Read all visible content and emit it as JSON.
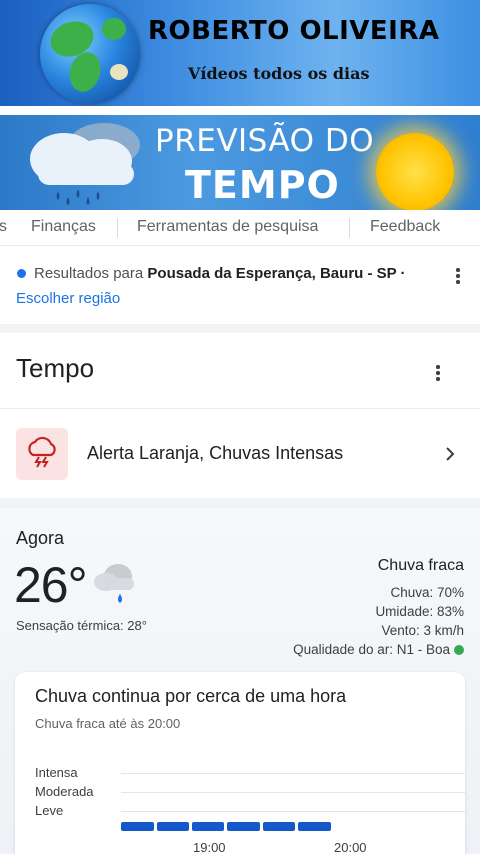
{
  "banner_top": {
    "title": "ROBERTO OLIVEIRA",
    "subtitle": "Vídeos todos os dias"
  },
  "banner_weather": {
    "line1": "PREVISÃO DO",
    "line2": "TEMPO"
  },
  "tabs": [
    {
      "label": "s"
    },
    {
      "label": "Finanças"
    },
    {
      "label": "Ferramentas de pesquisa"
    },
    {
      "label": "Feedback"
    }
  ],
  "location": {
    "prefix": "Resultados para ",
    "place": "Pousada da Esperança, Bauru - SP ·",
    "change_link": "Escolher região"
  },
  "tempo": {
    "heading": "Tempo"
  },
  "alert": {
    "label": "Alerta Laranja, Chuvas Intensas",
    "color": "#fbe3e3"
  },
  "now": {
    "label": "Agora",
    "temperature": "26°",
    "feels_like": "Sensação térmica: 28°",
    "condition": "Chuva fraca",
    "rain": "Chuva: 70%",
    "humidity": "Umidade: 83%",
    "wind": "Vento: 3 km/h",
    "air_quality": "Qualidade do ar: N1 - Boa",
    "air_quality_color": "#34a853"
  },
  "rain_card": {
    "title": "Chuva continua por cerca de uma hora",
    "subtitle": "Chuva fraca até às 20:00",
    "levels": [
      "Intensa",
      "Moderada",
      "Leve"
    ],
    "time_labels": [
      "19:00",
      "20:00"
    ],
    "bar_color": "#1558c9"
  }
}
